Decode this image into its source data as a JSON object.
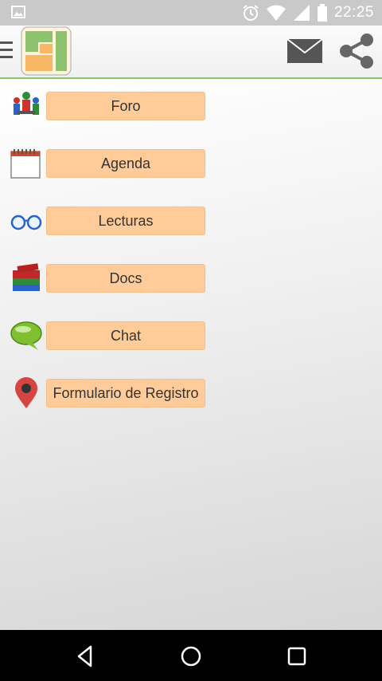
{
  "status_bar": {
    "time": "22:25",
    "icons": [
      "image-icon",
      "alarm-icon",
      "wifi-icon",
      "signal-icon",
      "battery-icon"
    ]
  },
  "app_bar": {
    "menu_icon": "hamburger-icon",
    "logo_icon": "app-logo",
    "actions": [
      "mail-icon",
      "share-icon"
    ],
    "accent_color": "#8dc26f"
  },
  "menu": {
    "button_color": "#ffcc99",
    "items": [
      {
        "label": "Foro",
        "icon": "people-icon"
      },
      {
        "label": "Agenda",
        "icon": "calendar-icon"
      },
      {
        "label": "Lecturas",
        "icon": "glasses-icon"
      },
      {
        "label": "Docs",
        "icon": "books-icon"
      },
      {
        "label": "Chat",
        "icon": "chat-bubble-icon"
      },
      {
        "label": "Formulario de Registro",
        "icon": "map-pin-icon"
      }
    ]
  },
  "nav_bar": {
    "buttons": [
      "back-icon",
      "home-icon",
      "recents-icon"
    ]
  }
}
